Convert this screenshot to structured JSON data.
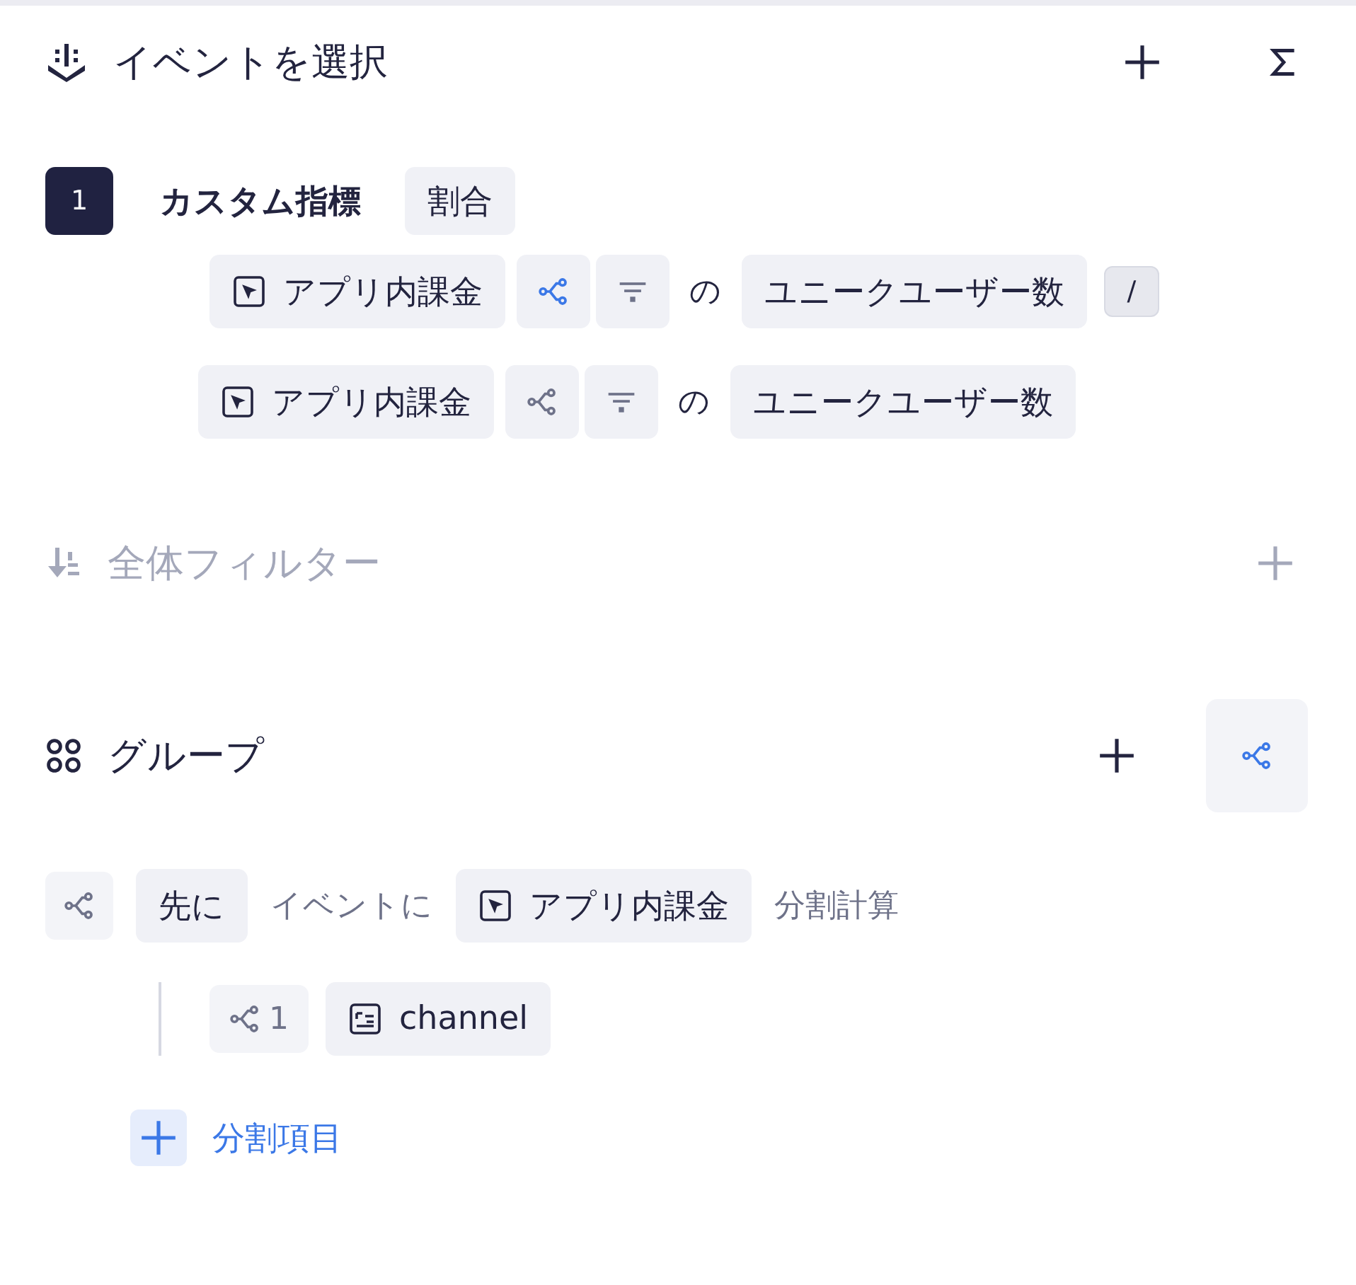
{
  "events": {
    "title": "イベントを選択"
  },
  "metric": {
    "index": "1",
    "name": "カスタム指標",
    "type": "割合",
    "terms": [
      {
        "event": "アプリ内課金",
        "split_active": true,
        "of": "の",
        "measure": "ユニークユーザー数",
        "operator": "/"
      },
      {
        "event": "アプリ内課金",
        "split_active": false,
        "of": "の",
        "measure": "ユニークユーザー数"
      }
    ]
  },
  "filter": {
    "title": "全体フィルター",
    "disabled": true
  },
  "group": {
    "title": "グループ",
    "split_active": true,
    "rule": {
      "order": "先に",
      "text": "イベントに",
      "event": "アプリ内課金",
      "suffix": "分割計算"
    },
    "items": [
      {
        "count": "1",
        "property": "channel"
      }
    ],
    "add_label": "分割項目"
  }
}
